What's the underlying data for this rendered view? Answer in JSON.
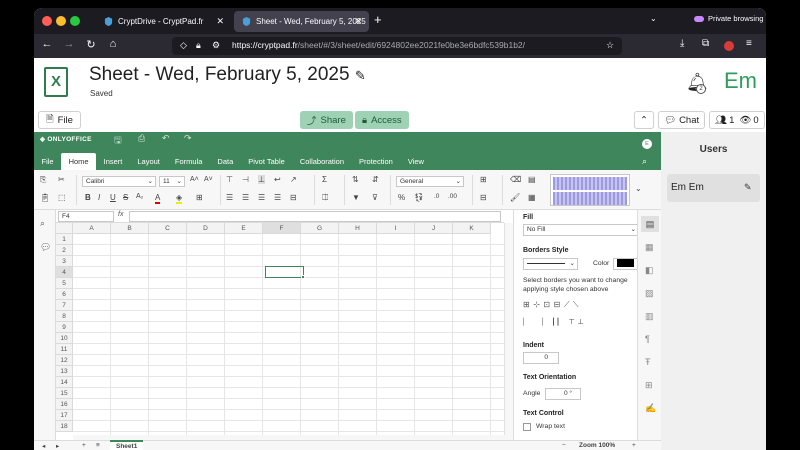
{
  "browser": {
    "tabs": [
      {
        "title": "CryptDrive - CryptPad.fr",
        "active": false
      },
      {
        "title": "Sheet - Wed, February 5, 2025",
        "active": true
      }
    ],
    "private_label": "Private browsing",
    "url_host": "https://cryptpad.fr",
    "url_path": "/sheet/#/3/sheet/edit/6924802ee2021fe0be3e6bdfc539b1b2/"
  },
  "doc": {
    "title": "Sheet - Wed, February 5, 2025",
    "status": "Saved",
    "file_icon_letter": "X",
    "notification_count": "2",
    "avatar_initials": "Em"
  },
  "toolbar": {
    "file_label": "File",
    "share_label": "Share",
    "access_label": "Access",
    "chat_label": "Chat",
    "users_count": "1",
    "viewers_count": "0"
  },
  "onlyoffice": {
    "logo": "ONLYOFFICE",
    "user_initial": "E",
    "tabs": [
      "File",
      "Home",
      "Insert",
      "Layout",
      "Formula",
      "Data",
      "Pivot Table",
      "Collaboration",
      "Protection",
      "View"
    ],
    "active_tab": "Home",
    "font_name": "Calibri",
    "font_size": "11",
    "number_format": "General",
    "cell_ref": "F4",
    "fx_label": "fx",
    "columns": [
      "A",
      "B",
      "C",
      "D",
      "E",
      "F",
      "G",
      "H",
      "I",
      "J",
      "K"
    ],
    "selected_column": "F",
    "rows": [
      "1",
      "2",
      "3",
      "4",
      "5",
      "6",
      "7",
      "8",
      "9",
      "10",
      "11",
      "12",
      "13",
      "14",
      "15",
      "16",
      "17",
      "18"
    ],
    "selected_row": "4",
    "sheet_tab": "Sheet1",
    "zoom_label": "Zoom 100%"
  },
  "cell_settings": {
    "fill_label": "Fill",
    "fill_value": "No Fill",
    "borders_label": "Borders Style",
    "color_label": "Color",
    "border_help": "Select borders you want to change applying style chosen above",
    "indent_label": "Indent",
    "indent_value": "0",
    "orientation_label": "Text Orientation",
    "angle_label": "Angle",
    "angle_value": "0 °",
    "text_control_label": "Text Control",
    "wrap_label": "Wrap text"
  },
  "users_panel": {
    "title": "Users",
    "user_initials": "Em",
    "user_name": "Em"
  },
  "colors": {
    "onlyoffice_green": "#40865c",
    "share_button": "#9fd2b4",
    "avatar_green": "#2e9e5b"
  }
}
